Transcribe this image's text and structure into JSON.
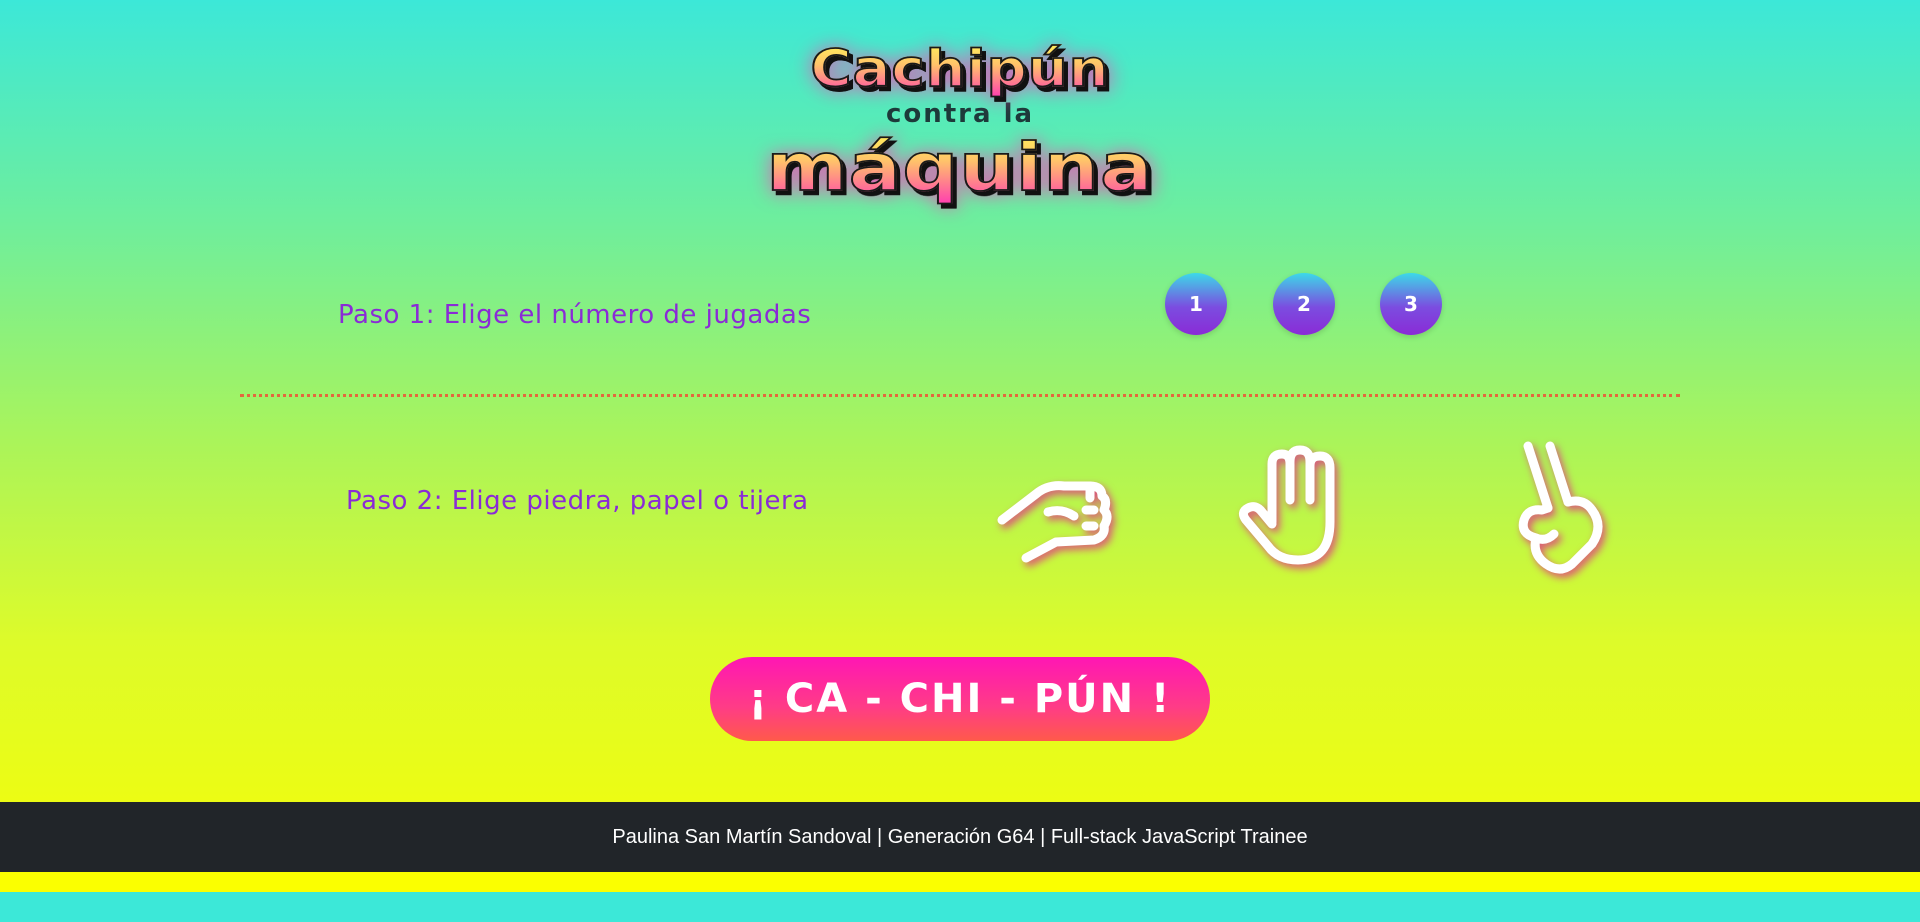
{
  "title": {
    "line1": "Cachipún",
    "line2": "contra la",
    "line3": "máquina"
  },
  "step1": {
    "label": "Paso 1: Elige el número de jugadas",
    "options": [
      "1",
      "2",
      "3"
    ]
  },
  "step2": {
    "label": "Paso 2: Elige piedra, papel o tijera",
    "hands": [
      "rock-hand-icon",
      "paper-hand-icon",
      "scissors-hand-icon"
    ]
  },
  "play_button": "¡ CA - CHI - PÚN !",
  "footer": "Paulina San Martín Sandoval | Generación G64 | Full-stack JavaScript Trainee",
  "colors": {
    "accent_purple": "#8a2bd6",
    "button_pink": "#ff16b4",
    "footer_bg": "#212529",
    "divider": "#e3683e"
  }
}
